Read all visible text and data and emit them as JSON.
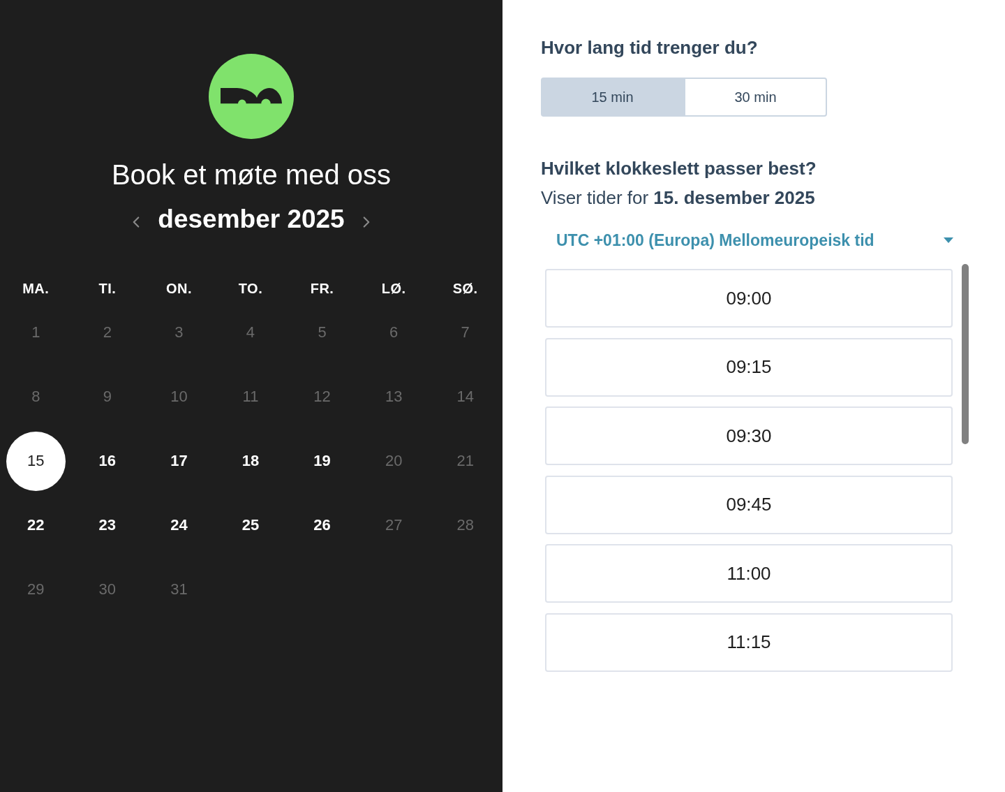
{
  "calendar": {
    "title": "Book et møte med oss",
    "month": "desember 2025",
    "weekdays": [
      "MA.",
      "TI.",
      "ON.",
      "TO.",
      "FR.",
      "LØ.",
      "SØ."
    ],
    "days": [
      {
        "label": "1",
        "available": false,
        "selected": false
      },
      {
        "label": "2",
        "available": false,
        "selected": false
      },
      {
        "label": "3",
        "available": false,
        "selected": false
      },
      {
        "label": "4",
        "available": false,
        "selected": false
      },
      {
        "label": "5",
        "available": false,
        "selected": false
      },
      {
        "label": "6",
        "available": false,
        "selected": false
      },
      {
        "label": "7",
        "available": false,
        "selected": false
      },
      {
        "label": "8",
        "available": false,
        "selected": false
      },
      {
        "label": "9",
        "available": false,
        "selected": false
      },
      {
        "label": "10",
        "available": false,
        "selected": false
      },
      {
        "label": "11",
        "available": false,
        "selected": false
      },
      {
        "label": "12",
        "available": false,
        "selected": false
      },
      {
        "label": "13",
        "available": false,
        "selected": false
      },
      {
        "label": "14",
        "available": false,
        "selected": false
      },
      {
        "label": "15",
        "available": true,
        "selected": true
      },
      {
        "label": "16",
        "available": true,
        "selected": false
      },
      {
        "label": "17",
        "available": true,
        "selected": false
      },
      {
        "label": "18",
        "available": true,
        "selected": false
      },
      {
        "label": "19",
        "available": true,
        "selected": false
      },
      {
        "label": "20",
        "available": false,
        "selected": false
      },
      {
        "label": "21",
        "available": false,
        "selected": false
      },
      {
        "label": "22",
        "available": true,
        "selected": false
      },
      {
        "label": "23",
        "available": true,
        "selected": false
      },
      {
        "label": "24",
        "available": true,
        "selected": false
      },
      {
        "label": "25",
        "available": true,
        "selected": false
      },
      {
        "label": "26",
        "available": true,
        "selected": false
      },
      {
        "label": "27",
        "available": false,
        "selected": false
      },
      {
        "label": "28",
        "available": false,
        "selected": false
      },
      {
        "label": "29",
        "available": false,
        "selected": false
      },
      {
        "label": "30",
        "available": false,
        "selected": false
      },
      {
        "label": "31",
        "available": false,
        "selected": false
      }
    ]
  },
  "duration": {
    "heading": "Hvor lang tid trenger du?",
    "options": [
      {
        "label": "15 min",
        "selected": true
      },
      {
        "label": "30 min",
        "selected": false
      }
    ]
  },
  "time": {
    "heading": "Hvilket klokkeslett passer best?",
    "subtitle": "Viser tider for **15. desember 2025**",
    "timezone": "UTC +01:00 (Europa) Mellomeuropeisk tid",
    "slots": [
      "09:00",
      "09:15",
      "09:30",
      "09:45",
      "11:00",
      "11:15"
    ]
  }
}
